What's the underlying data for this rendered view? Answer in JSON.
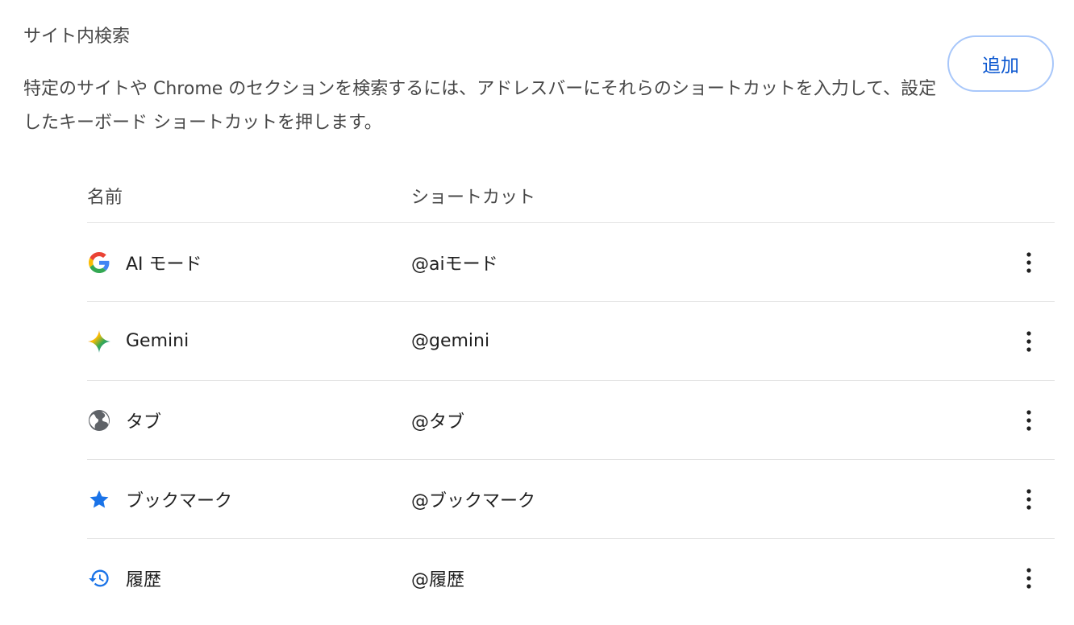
{
  "section": {
    "title": "サイト内検索",
    "description": "特定のサイトや Chrome のセクションを検索するには、アドレスバーにそれらのショートカットを入力して、設定したキーボード ショートカットを押します。",
    "add_label": "追加"
  },
  "table": {
    "columns": {
      "name": "名前",
      "shortcut": "ショートカット"
    },
    "rows": [
      {
        "icon": "google-g-icon",
        "name": "AI モード",
        "shortcut": "@aiモード"
      },
      {
        "icon": "gemini-sparkle-icon",
        "name": "Gemini",
        "shortcut": "@gemini"
      },
      {
        "icon": "globe-icon",
        "name": "タブ",
        "shortcut": "@タブ"
      },
      {
        "icon": "star-icon",
        "name": "ブックマーク",
        "shortcut": "@ブックマーク"
      },
      {
        "icon": "history-icon",
        "name": "履歴",
        "shortcut": "@履歴"
      }
    ],
    "more_icon": "more-vert-icon"
  },
  "colors": {
    "accent": "#0b57d0",
    "button_border": "#a8c7fa",
    "divider": "#e3e3e3",
    "star_blue": "#1a73e8",
    "history_blue": "#1a73e8",
    "globe_gray": "#5f6368"
  }
}
